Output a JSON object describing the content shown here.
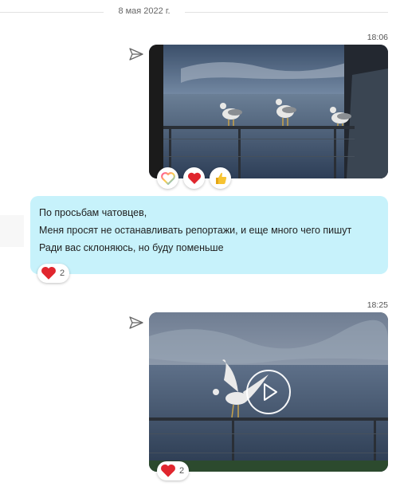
{
  "chat": {
    "date_separator": "8 мая 2022 г.",
    "messages": [
      {
        "kind": "photo",
        "time": "18:06",
        "reactions": [
          "heart-rainbow",
          "heart-red",
          "thumbs-up"
        ]
      },
      {
        "kind": "text",
        "lines": [
          "По просьбам чатовцев,",
          "Меня просят не останавливать репортажи, и еще много чего пишут",
          "Ради вас склоняюсь, но буду поменьше"
        ],
        "reaction": {
          "icon": "heart-red",
          "count": "2"
        }
      },
      {
        "kind": "video",
        "time": "18:25",
        "reaction": {
          "icon": "heart-red",
          "count": "2"
        }
      }
    ]
  },
  "colors": {
    "bubble": "#c7f2fb",
    "heart": "#e0262e",
    "separator": "#e2e2e2"
  }
}
